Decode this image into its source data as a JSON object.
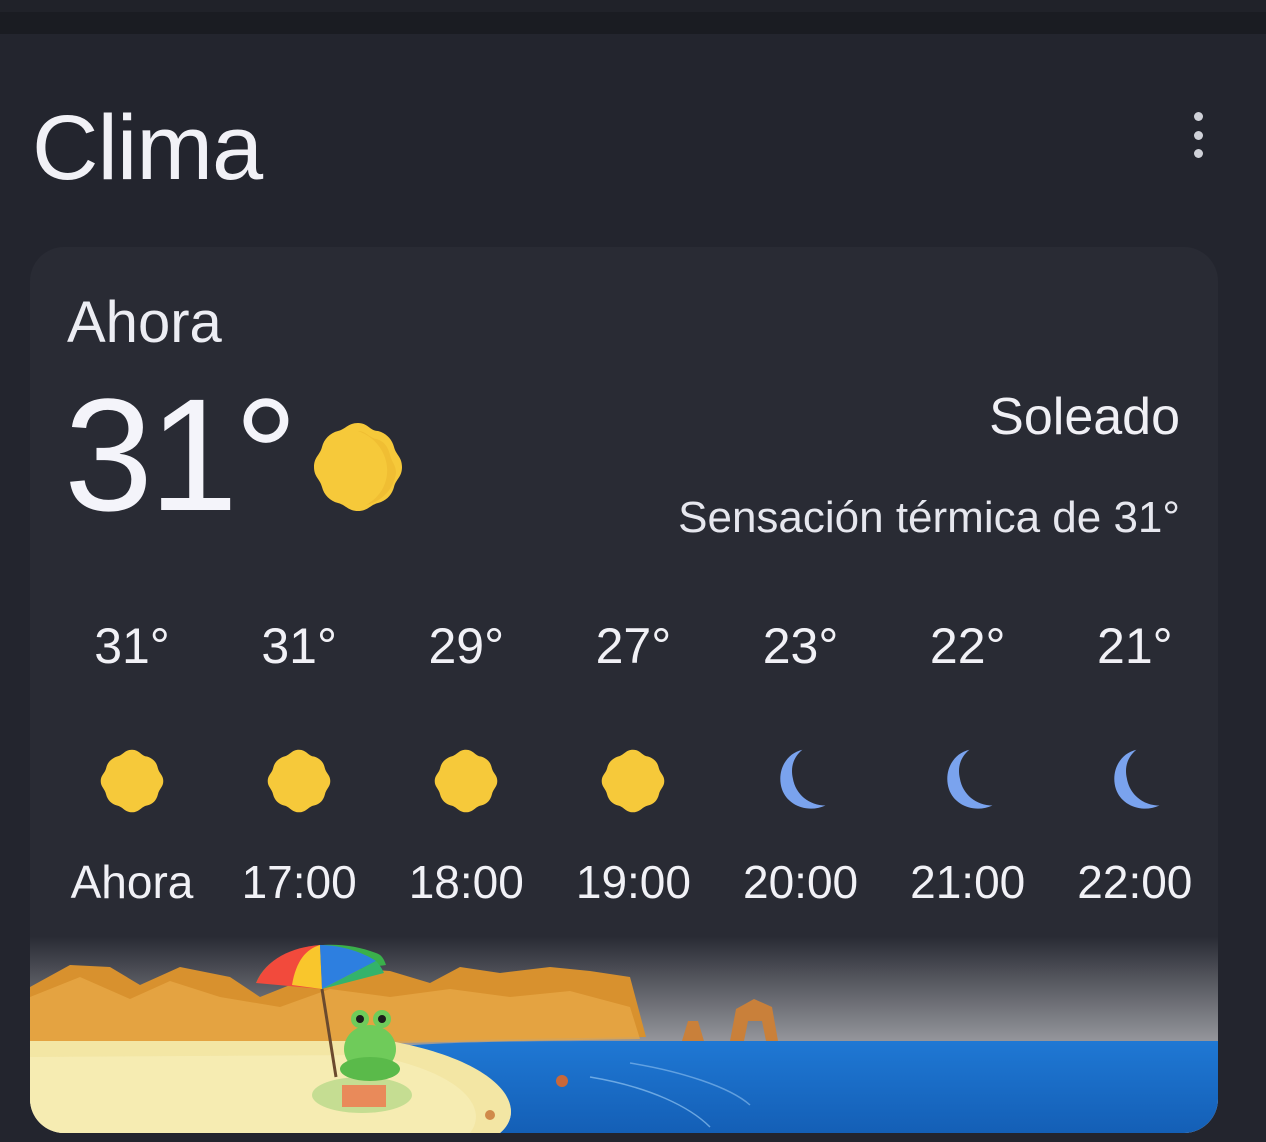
{
  "header": {
    "title": "Clima",
    "menu_icon": "more-vert-icon"
  },
  "current": {
    "label": "Ahora",
    "temperature": "31°",
    "icon": "sun-icon",
    "condition": "Soleado",
    "feels_like": "Sensación térmica de 31°"
  },
  "hourly": [
    {
      "temp": "31°",
      "time": "Ahora",
      "icon": "sun-icon"
    },
    {
      "temp": "31°",
      "time": "17:00",
      "icon": "sun-icon"
    },
    {
      "temp": "29°",
      "time": "18:00",
      "icon": "sun-icon"
    },
    {
      "temp": "27°",
      "time": "19:00",
      "icon": "sun-icon"
    },
    {
      "temp": "23°",
      "time": "20:00",
      "icon": "moon-icon"
    },
    {
      "temp": "22°",
      "time": "21:00",
      "icon": "moon-icon"
    },
    {
      "temp": "21°",
      "time": "22:00",
      "icon": "moon-icon"
    }
  ],
  "colors": {
    "background": "#23252e",
    "card": "#292b34",
    "sun": "#f6c93a",
    "moon": "#7aa3ee"
  }
}
